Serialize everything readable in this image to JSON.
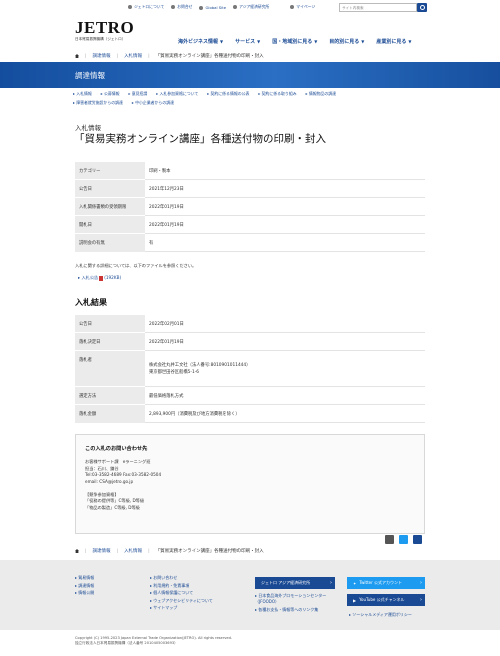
{
  "header": {
    "logo": "JETRO",
    "logo_sub": "日本貿易振興機構（ジェトロ）",
    "top_links": [
      "ジェトロについて",
      "お問合せ",
      "Global Site",
      "アジア経済研究所",
      "マイページ"
    ],
    "search_placeholder": "サイト内検索",
    "main_nav": [
      "海外ビジネス情報",
      "サービス",
      "国・地域別に見る",
      "目的別に見る",
      "産業別に見る"
    ]
  },
  "breadcrumb": [
    "調達情報",
    "入札情報",
    "「貿易実務オンライン講座」各種送付物の印刷・封入"
  ],
  "banner_title": "調達情報",
  "sublinks": [
    [
      "入札情報",
      "公募情報",
      "意見招請",
      "入札参加資格について",
      "契約に係る情報の公表",
      "契約に係る取り組み",
      "情報物品の調達"
    ],
    [
      "障害者就労施設からの調達",
      "中小企業者からの調達"
    ]
  ],
  "page": {
    "pre_title": "入札情報",
    "title": "「貿易実務オンライン講座」各種送付物の印刷・封入"
  },
  "info_rows": [
    {
      "k": "カテゴリー",
      "v": "印刷・製本"
    },
    {
      "k": "公告日",
      "v": "2021年12月23日"
    },
    {
      "k": "入札関係書類の受領期限",
      "v": "2022年01月19日"
    },
    {
      "k": "開札日",
      "v": "2022年01月19日"
    },
    {
      "k": "説明会の有無",
      "v": "有"
    }
  ],
  "note": "入札に関する詳細については、以下のファイルを参照ください。",
  "file_link": "入札公告",
  "file_size": "(192KB)",
  "result_heading": "入札結果",
  "result_rows": [
    {
      "k": "公告日",
      "v": "2022年02月01日"
    },
    {
      "k": "落札決定日",
      "v": "2022年01月19日"
    },
    {
      "k": "落札者",
      "v": "株式会社丸井工文社（法人番号:8010901011444）\n東京都世田谷区船橋5-1-6"
    },
    {
      "k": "選定方法",
      "v": "最低価格落札方式"
    },
    {
      "k": "落札金額",
      "v": "2,893,900円（消費税及び地方消費税を除く）"
    }
  ],
  "contact": {
    "title": "この入札のお問い合わせ先",
    "body": "お客様サポート課　eラーニング班\n担当：石川、鎌谷\nTel:03-3582-4689 Fax:03-3582-0504\nemail: CSA@jetro.go.jp\n\n【競争参加資格】\n「役務の提供等」C等級, D等級\n「物品の製造」C等級, D等級"
  },
  "footer": {
    "col1": [
      "貿易情報",
      "調達情報",
      "情報公開"
    ],
    "col2": [
      "お問い合わせ",
      "利用規約・免責事項",
      "個人情報保護について",
      "ウェブアクセシビリティについて",
      "サイトマップ"
    ],
    "col3_buttons": [
      "ジェトロ アジア経済研究所"
    ],
    "col3_links": [
      "日本食品海外プロモーションセンター（JFOODO）",
      "各種お支払・情報等へのリンク集"
    ],
    "social": [
      "Twitter 公式アカウント",
      "YouTube 公式チャンネル"
    ],
    "social_link": "ソーシャルメディア運用ポリシー",
    "copyright": "Copyright (C) 1995-2023 Japan External Trade Organization(JETRO). All rights reserved.",
    "org": "独立行政法人日本貿易振興機構（法人番号 2010405003693）"
  },
  "colors": {
    "brand_blue": "#1a4a94",
    "twitter": "#1d9bf0",
    "youtube": "#1a4a94"
  }
}
